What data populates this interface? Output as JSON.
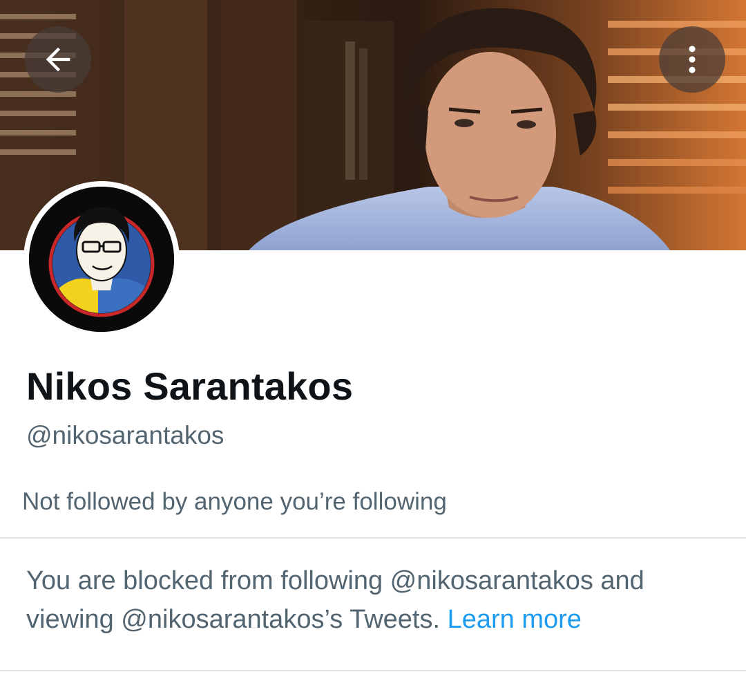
{
  "profile": {
    "display_name": "Nikos Sarantakos",
    "handle": "@nikosarantakos",
    "followers_you_know": "Not followed by anyone you’re following"
  },
  "blocked_notice": {
    "text": "You are blocked from following @nikosarantakos and viewing @nikosarantakos’s Tweets.",
    "link_label": "Learn more"
  },
  "icons": {
    "back": "arrow-left-icon",
    "more": "more-vertical-icon"
  },
  "colors": {
    "primary_text": "#0f1419",
    "secondary_text": "#536471",
    "link": "#1d9bf0",
    "divider": "#e1e5e8"
  }
}
